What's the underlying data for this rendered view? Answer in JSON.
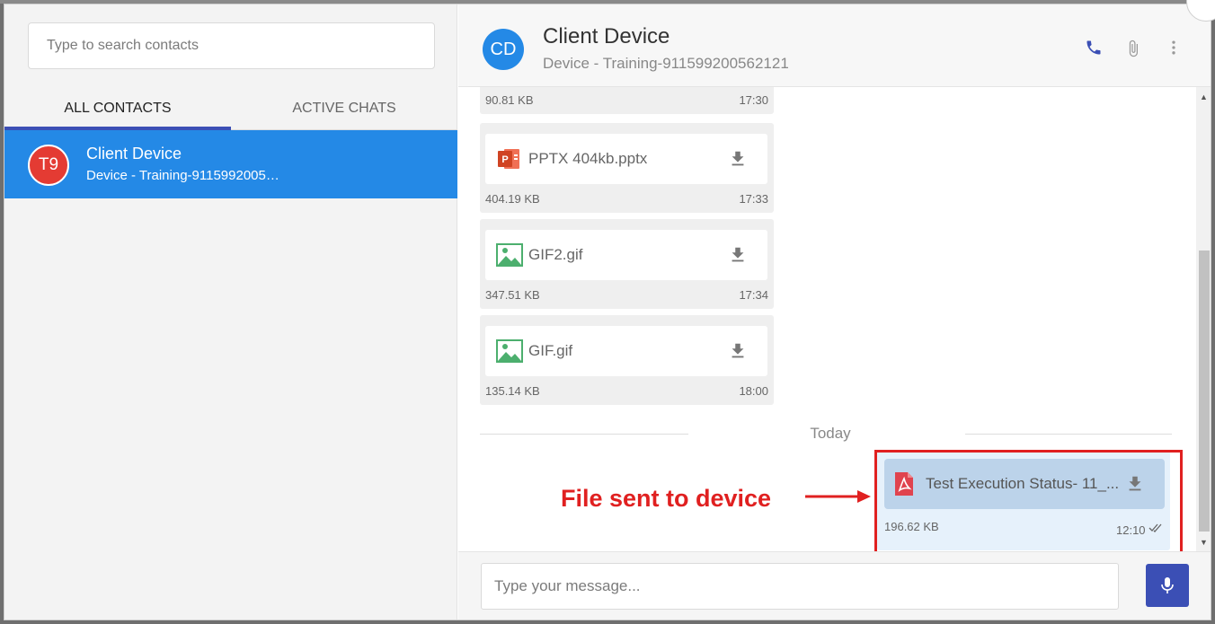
{
  "contacts_panel": {
    "search_placeholder": "Type to search contacts",
    "tabs": [
      {
        "label": "ALL CONTACTS",
        "active": true
      },
      {
        "label": "ACTIVE CHATS",
        "active": false
      }
    ],
    "contacts": [
      {
        "avatar": "T9",
        "name": "Client Device",
        "subtitle": "Device - Training-9115992005…",
        "selected": true
      }
    ]
  },
  "chat_header": {
    "avatar": "CD",
    "title": "Client Device",
    "subtitle": "Device - Training-911599200562121",
    "icons": [
      "phone-icon",
      "attachment-icon",
      "more-vert-icon"
    ]
  },
  "messages": [
    {
      "size": "90.81 KB",
      "time": "17:30"
    },
    {
      "file_name": "PPTX 404kb.pptx",
      "file_icon": "pptx-file-icon",
      "size": "404.19 KB",
      "time": "17:33"
    },
    {
      "file_name": "GIF2.gif",
      "file_icon": "image-file-icon",
      "size": "347.51 KB",
      "time": "17:34"
    },
    {
      "file_name": "GIF.gif",
      "file_icon": "image-file-icon",
      "size": "135.14 KB",
      "time": "18:00"
    }
  ],
  "date_separator": "Today",
  "sent_message": {
    "file_name": "Test Execution Status- 11_...",
    "file_icon": "pdf-file-icon",
    "size": "196.62 KB",
    "time": "12:10",
    "status_icon": "double-check-icon"
  },
  "annotation": {
    "text": "File sent to device",
    "color": "#e02020"
  },
  "compose": {
    "placeholder": "Type your message..."
  },
  "colors": {
    "accent": "#3b4fb5",
    "selected_contact": "#2489e6",
    "avatar_red": "#e43b33"
  }
}
